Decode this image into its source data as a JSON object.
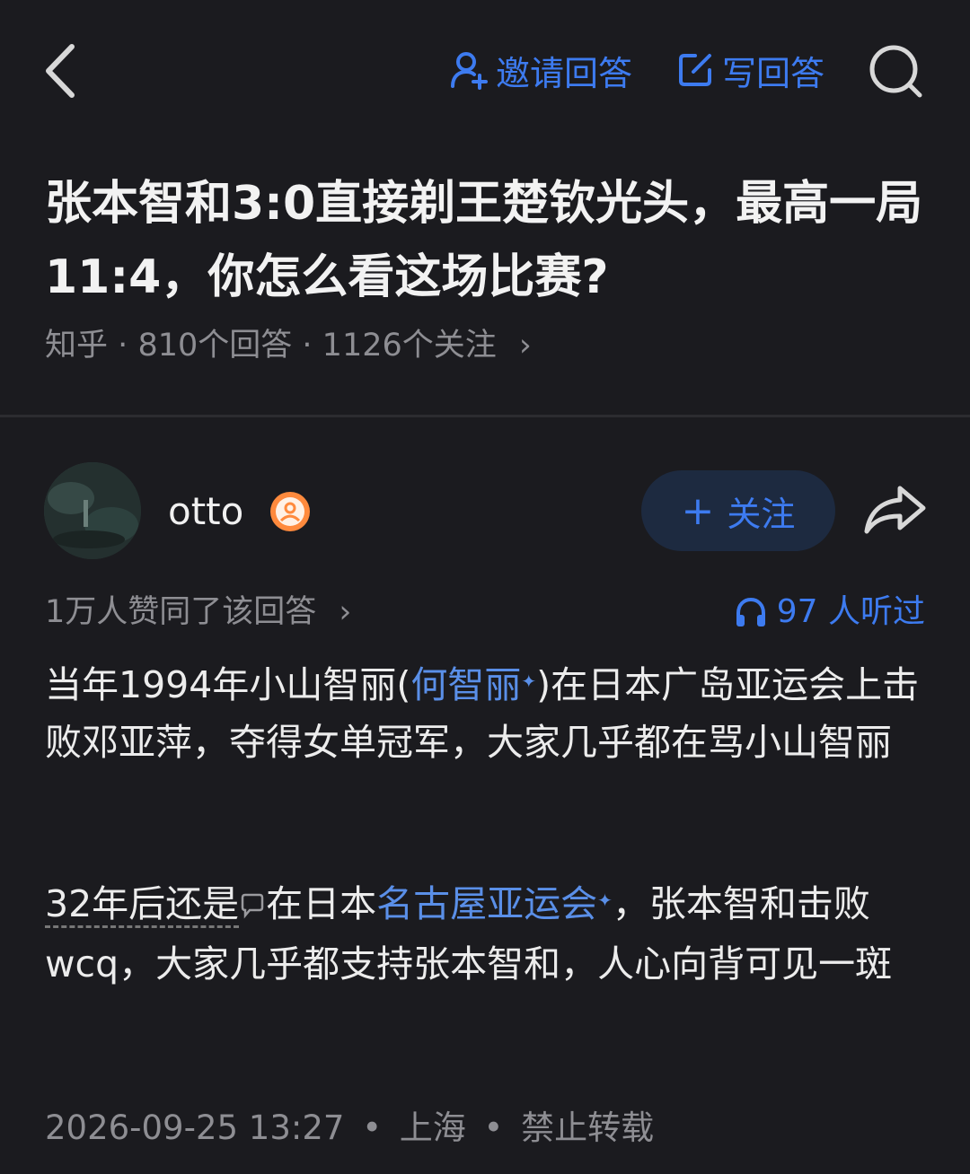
{
  "header": {
    "invite_label": "邀请回答",
    "write_label": "写回答"
  },
  "question": {
    "title": "张本智和3:0直接剃王楚钦光头，最高一局11:4，你怎么看这场比赛?",
    "source": "知乎",
    "answers": "810个回答",
    "followers": "1126个关注",
    "separator": "·",
    "chevron": "›"
  },
  "answer": {
    "author": {
      "name": "otto",
      "follow_label": "关注",
      "follow_plus": "+"
    },
    "approvals": "1万人赞同了该回答",
    "approvals_chevron": "›",
    "listened": "97 人听过",
    "para1": {
      "before": "当年1994年小山智丽(",
      "link": "何智丽",
      "after": ")在日本广岛亚运会上击败邓亚萍，夺得女单冠军，大家几乎都在骂小山智丽"
    },
    "para2": {
      "dashed": "32年后还是",
      "middle": "在日本",
      "link": "名古屋亚运会",
      "after": "，张本智和击败wcq，大家几乎都支持张本智和，人心向背可见一斑"
    },
    "spark": "✦",
    "footer": {
      "date": "2026-09-25 13:27",
      "location": "上海",
      "copyright": "禁止转载",
      "separator": "•"
    }
  },
  "colors": {
    "background": "#1b1b1f",
    "accent": "#3d7bf0",
    "link": "#5a8fe8",
    "muted": "#8e8e93"
  }
}
